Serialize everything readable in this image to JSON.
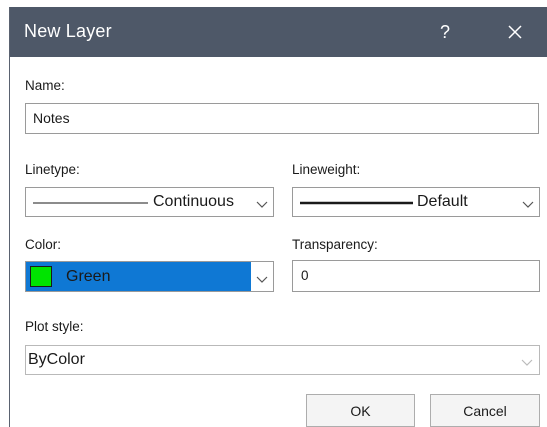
{
  "dialog": {
    "title": "New Layer",
    "help_glyph": "?",
    "close_icon": "close-icon"
  },
  "name": {
    "label": "Name:",
    "value": "Notes"
  },
  "linetype": {
    "label": "Linetype:",
    "value": "Continuous",
    "icon": "chevron-down-icon"
  },
  "lineweight": {
    "label": "Lineweight:",
    "value": "Default",
    "icon": "chevron-down-icon"
  },
  "color": {
    "label": "Color:",
    "value": "Green",
    "swatch_color": "#00e400",
    "highlight_color": "#0f78d4",
    "icon": "chevron-down-icon"
  },
  "transparency": {
    "label": "Transparency:",
    "value": "0"
  },
  "plot_style": {
    "label": "Plot style:",
    "value": "ByColor",
    "icon": "chevron-down-icon"
  },
  "buttons": {
    "ok": "OK",
    "cancel": "Cancel"
  },
  "colors": {
    "titlebar": "#4e5868",
    "accent": "#0f78d4"
  }
}
